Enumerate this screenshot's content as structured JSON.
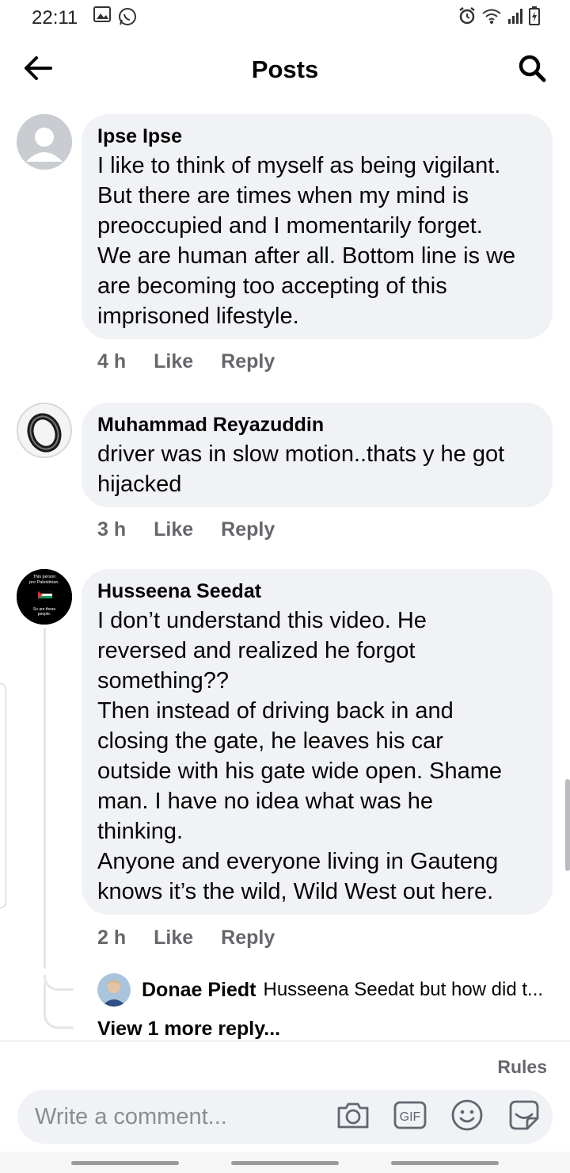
{
  "status_bar": {
    "time": "22:11",
    "left_icons": [
      "gallery-icon",
      "whatsapp-icon"
    ],
    "right_icons": [
      "alarm-icon",
      "wifi-icon",
      "signal-icon",
      "battery-charging-icon"
    ]
  },
  "header": {
    "title": "Posts",
    "back_icon": "back-arrow-icon",
    "search_icon": "search-icon"
  },
  "comments": [
    {
      "author": "Ipse Ipse",
      "text": "I like to think of myself as being vigilant.\nBut there are times when my mind is\npreoccupied and I momentarily forget.\nWe are human after all. Bottom line is we\nare becoming too accepting of this\nimprisoned lifestyle.",
      "time": "4 h",
      "like_label": "Like",
      "reply_label": "Reply"
    },
    {
      "author": "Muhammad Reyazuddin",
      "text": "driver was in slow motion..thats y he got\nhijacked",
      "time": "3 h",
      "like_label": "Like",
      "reply_label": "Reply"
    },
    {
      "author": "Husseena Seedat",
      "avatar_text": {
        "line1": "This person",
        "line2": "pro Palestinian.",
        "line3": "So are these",
        "line4": "people."
      },
      "text": "I don’t understand this video. He\nreversed and realized he forgot\nsomething??\nThen instead of driving back in and\nclosing the gate, he leaves his car\noutside with his gate wide open. Shame\nman. I have no idea what was he\nthinking.\nAnyone and everyone living in Gauteng\nknows it’s the wild, Wild West out here.",
      "time": "2 h",
      "like_label": "Like",
      "reply_label": "Reply",
      "reply_preview": {
        "author": "Donae Piedt",
        "text": "Husseena Seedat but how did t..."
      },
      "view_more": "View 1 more reply..."
    }
  ],
  "composer": {
    "rules_label": "Rules",
    "placeholder": "Write a comment...",
    "icons": [
      "camera-icon",
      "gif-icon",
      "emoji-icon",
      "sticker-icon"
    ],
    "gif_label": "GIF"
  },
  "colors": {
    "bubble": "#f0f2f5",
    "meta_text": "#65676b",
    "primary_text": "#050505"
  }
}
